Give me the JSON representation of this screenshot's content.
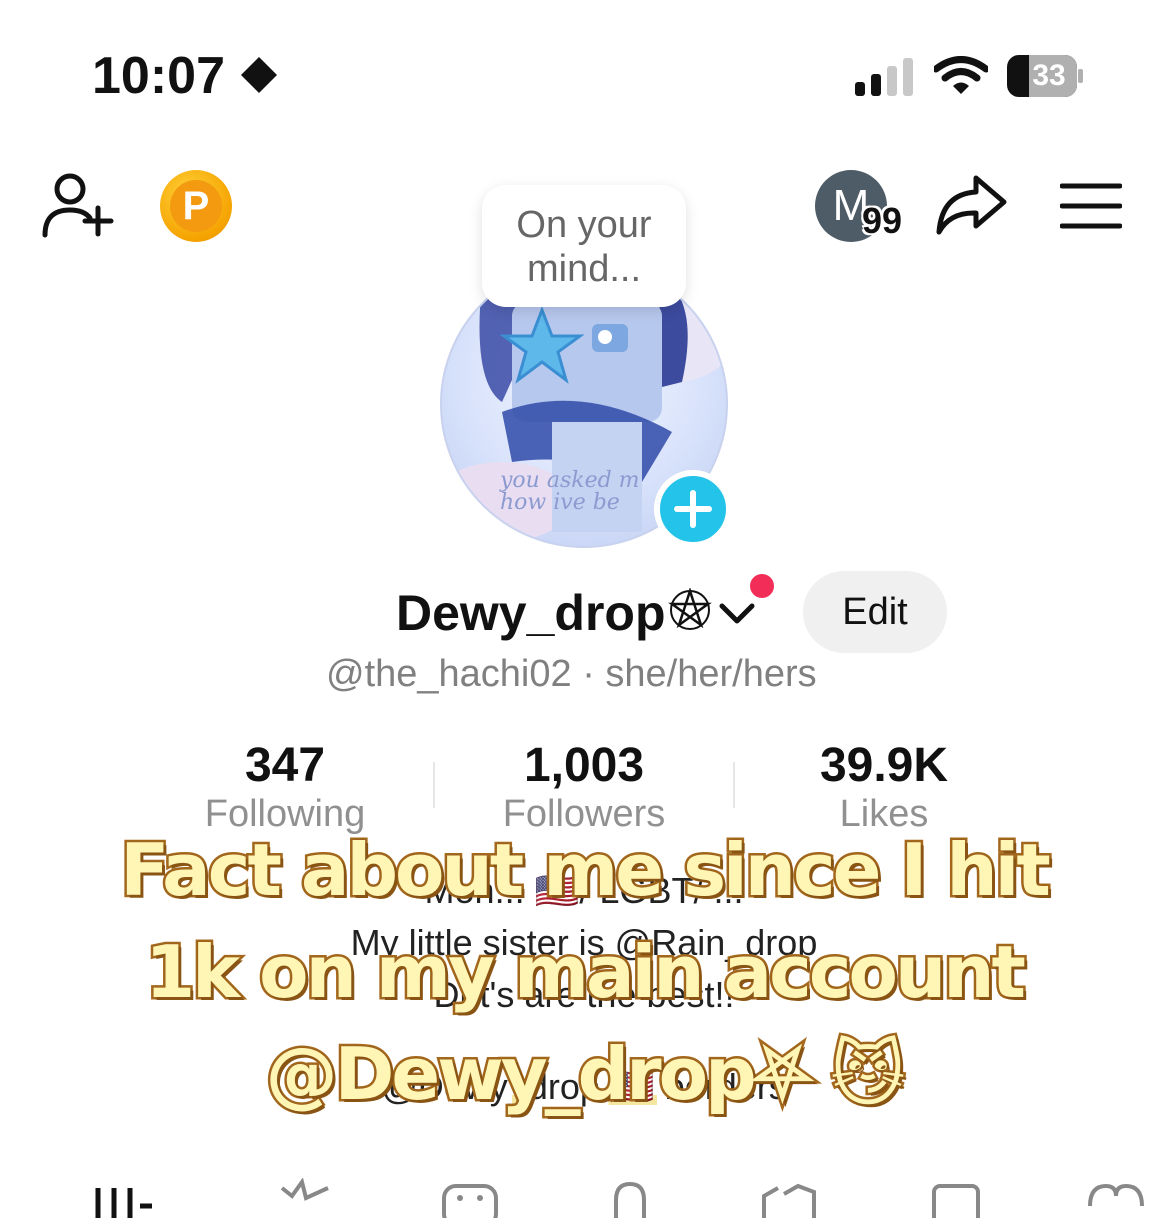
{
  "status_bar": {
    "time": "10:07",
    "battery": "33"
  },
  "profile": {
    "avatar_text": "you asked m how ive be",
    "bubble_text": "On your mind...",
    "display_name": "Dewy_drop",
    "handle": "@the_hachi02 · she/her/hers",
    "edit_label": "Edit",
    "messages_avatar_letter": "M",
    "messages_badge": "99",
    "coin_letter": "P"
  },
  "stats": [
    {
      "value": "347",
      "label": "Following"
    },
    {
      "value": "1,003",
      "label": "Followers"
    },
    {
      "value": "39.9K",
      "label": "Likes"
    }
  ],
  "bio": {
    "line1": "Mon... 🇺🇸/ LGBT/ ...",
    "line2": "My little sister is @Rain_drop",
    "line3": "Dirt's are the best!!",
    "line4": "@Dewy_drop 🇺🇸 borders"
  },
  "overlay": {
    "line1": "Fact about me since I hit",
    "line2": "1k on my main account",
    "line3": "@Dewy_drop⛧ 😼"
  },
  "colors": {
    "overlay_fill": "#fff6b6",
    "overlay_stroke": "#a66a1e",
    "plus_button": "#23c3ea",
    "notification_dot": "#f22e58",
    "coin": "#f5a300"
  }
}
